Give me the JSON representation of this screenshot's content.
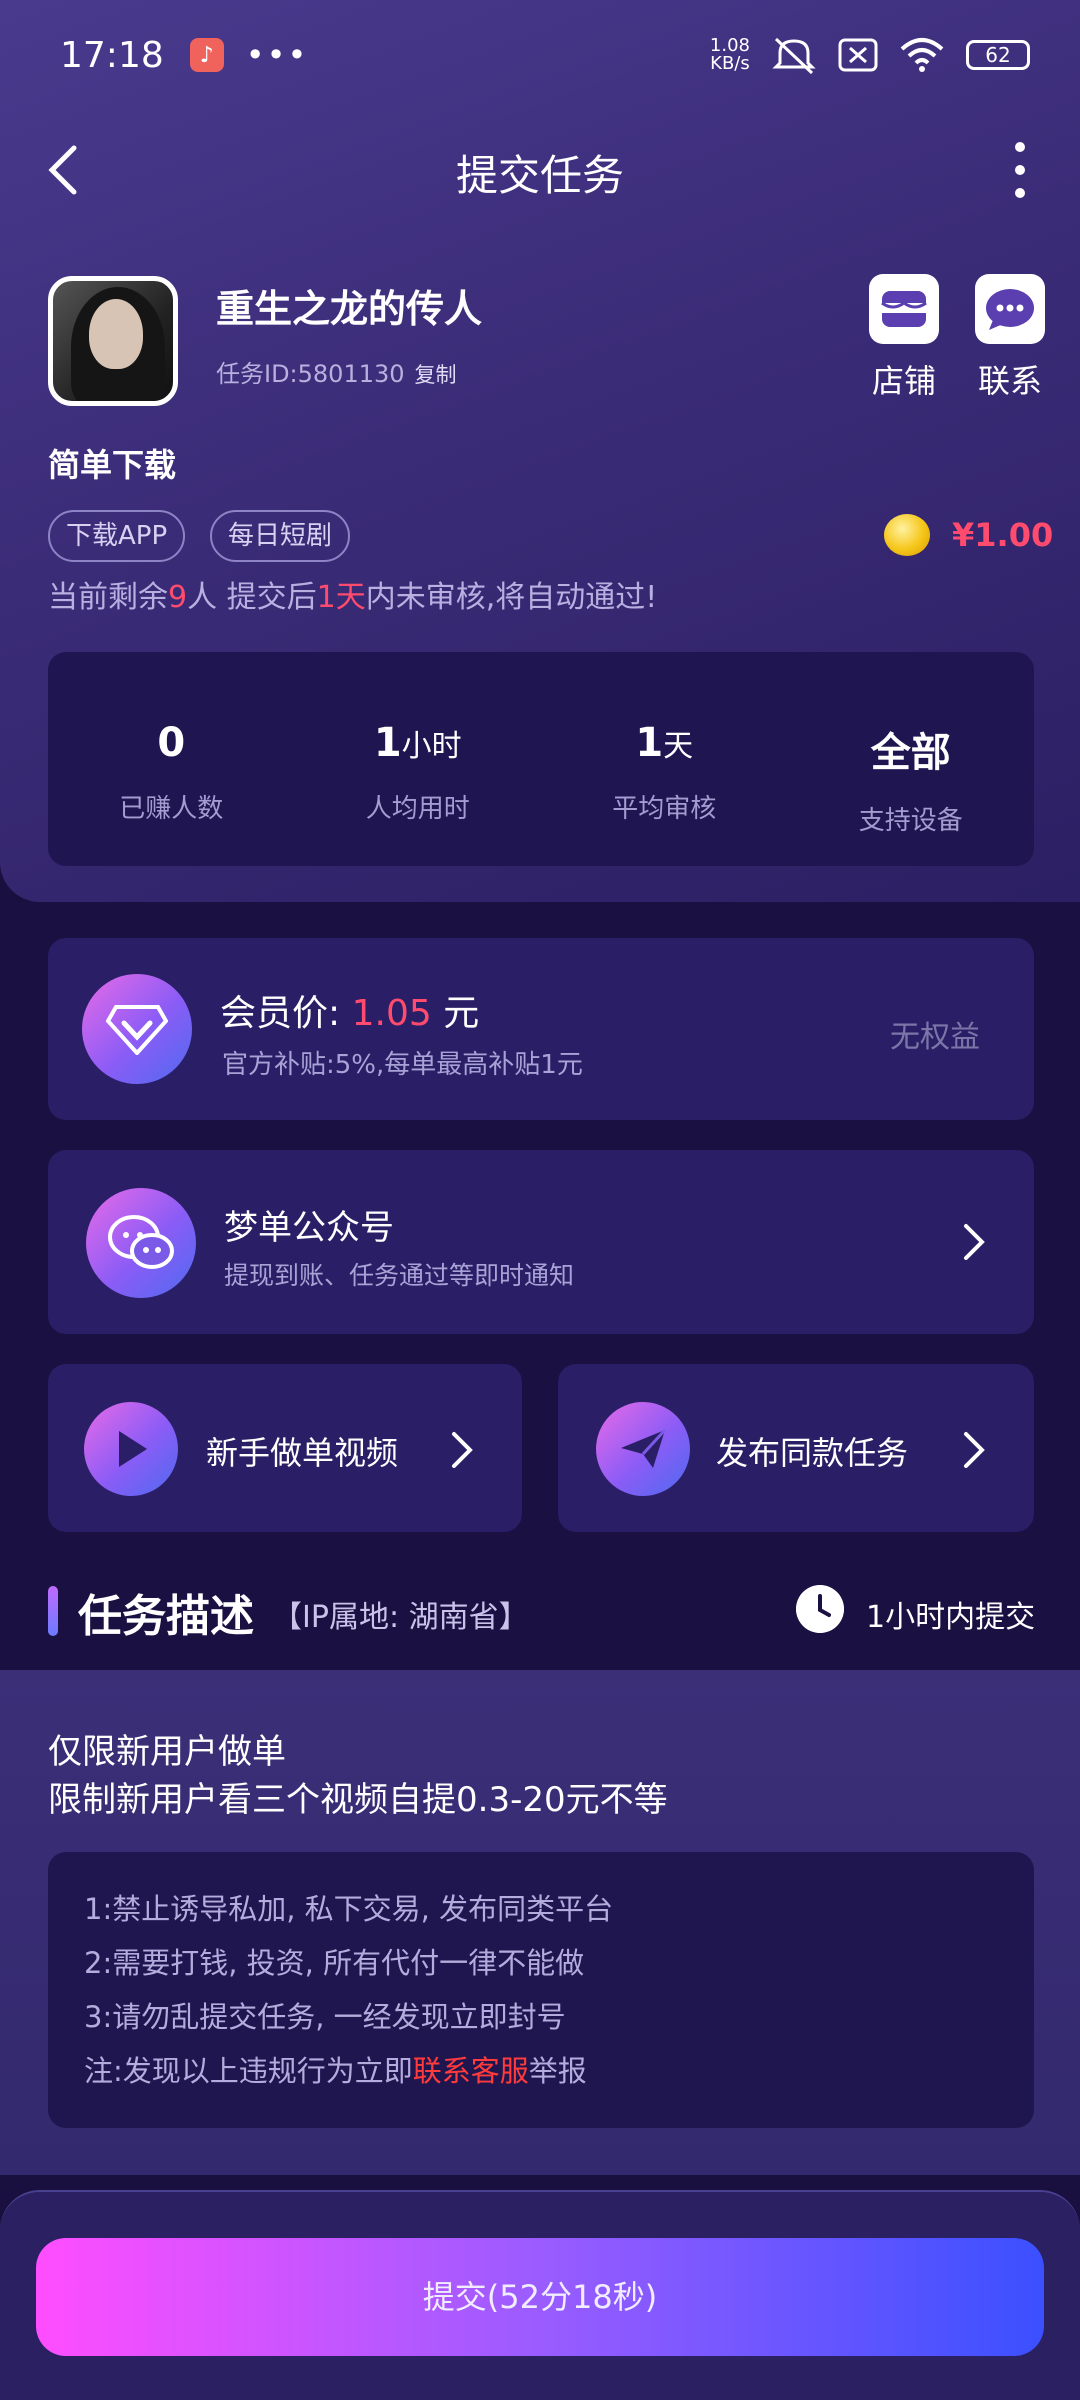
{
  "status": {
    "time": "17:18",
    "speed_value": "1.08",
    "speed_unit": "KB/s",
    "battery": "62"
  },
  "nav": {
    "title": "提交任务"
  },
  "task": {
    "name": "重生之龙的传人",
    "id_label": "任务ID:5801130",
    "copy": "复制",
    "shop": "店铺",
    "contact": "联系",
    "subtitle": "简单下载",
    "tags": [
      "下载APP",
      "每日短剧"
    ],
    "price": "¥1.00",
    "remain_pre": "当前剩余",
    "remain_num": "9",
    "remain_mid": "人  提交后",
    "remain_days": "1天",
    "remain_post": "内未审核,将自动通过!"
  },
  "stats": [
    {
      "value": "0",
      "unit": "",
      "label": "已赚人数"
    },
    {
      "value": "1",
      "unit": "小时",
      "label": "人均用时"
    },
    {
      "value": "1",
      "unit": "天",
      "label": "平均审核"
    },
    {
      "value": "全部",
      "unit": "",
      "label": "支持设备"
    }
  ],
  "vip": {
    "label": "会员价:",
    "price": "1.05",
    "unit": "元",
    "sub": "官方补贴:5%,每单最高补贴1元",
    "right": "无权益"
  },
  "wechat": {
    "title": "梦单公众号",
    "sub": "提现到账、任务通过等即时通知"
  },
  "actions": {
    "tutorial": "新手做单视频",
    "publish": "发布同款任务"
  },
  "section": {
    "title": "任务描述",
    "ip": "【IP属地: 湖南省】",
    "submit_in": "1小时内提交"
  },
  "description": {
    "line1": "仅限新用户做单",
    "line2": "限制新用户看三个视频自提0.3-20元不等",
    "rules": [
      "1:禁止诱导私加, 私下交易, 发布同类平台",
      "2:需要打钱, 投资, 所有代付一律不能做",
      "3:请勿乱提交任务, 一经发现立即封号"
    ],
    "note_pre": "注:发现以上违规行为立即",
    "note_link": "联系客服",
    "note_post": "举报"
  },
  "submit": {
    "label": "提交(52分18秒)"
  },
  "colors": {
    "accent_red": "#ff4b6e",
    "bg": "#1a1040",
    "card": "#2a1f66"
  }
}
